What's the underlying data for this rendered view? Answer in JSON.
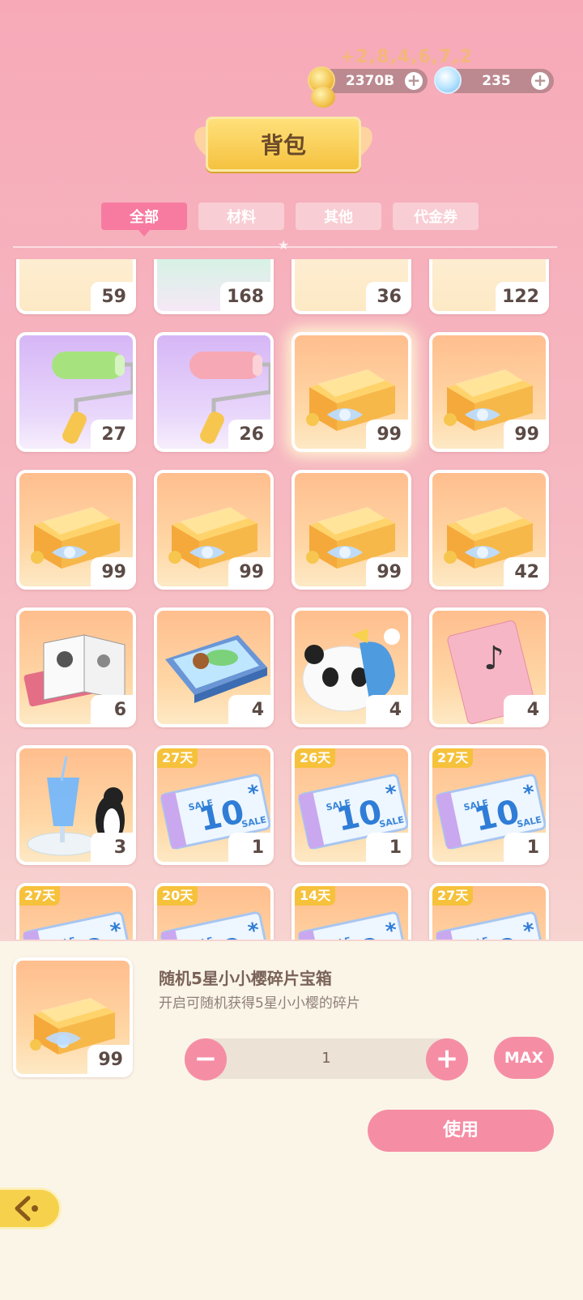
{
  "header": {
    "faded_label": "+2,8,4,6,7,2",
    "currencies": [
      {
        "name": "coin",
        "value": "2370B",
        "plus": "+"
      },
      {
        "name": "gem",
        "value": "235",
        "plus": "+"
      }
    ],
    "title": "背包"
  },
  "tabs": [
    {
      "label": "全部",
      "active": true
    },
    {
      "label": "材料",
      "active": false
    },
    {
      "label": "其他",
      "active": false
    },
    {
      "label": "代金券",
      "active": false
    }
  ],
  "items": [
    {
      "art": "card-icon",
      "count": "59",
      "days": ""
    },
    {
      "art": "ticket-blue-icon",
      "count": "168",
      "days": ""
    },
    {
      "art": "ticket-pink-icon",
      "count": "36",
      "days": ""
    },
    {
      "art": "ticket-yellow-icon",
      "count": "122",
      "days": ""
    },
    {
      "art": "green-roller-icon",
      "count": "27",
      "days": ""
    },
    {
      "art": "pink-roller-icon",
      "count": "26",
      "days": ""
    },
    {
      "art": "treasure-box-icon",
      "count": "99",
      "days": ""
    },
    {
      "art": "treasure-box-icon",
      "count": "99",
      "days": ""
    },
    {
      "art": "treasure-box-icon",
      "count": "99",
      "days": ""
    },
    {
      "art": "treasure-box-icon",
      "count": "99",
      "days": ""
    },
    {
      "art": "treasure-box-icon",
      "count": "99",
      "days": ""
    },
    {
      "art": "treasure-box-icon",
      "count": "42",
      "days": ""
    },
    {
      "art": "book-icon",
      "count": "6",
      "days": ""
    },
    {
      "art": "puzzle-box-icon",
      "count": "4",
      "days": ""
    },
    {
      "art": "panda-icon",
      "count": "4",
      "days": ""
    },
    {
      "art": "music-card-icon",
      "count": "4",
      "days": ""
    },
    {
      "art": "drink-penguin-icon",
      "count": "3",
      "days": ""
    },
    {
      "art": "coupon-icon",
      "count": "1",
      "days": "27天"
    },
    {
      "art": "coupon-icon",
      "count": "1",
      "days": "26天"
    },
    {
      "art": "coupon-icon",
      "count": "1",
      "days": "27天"
    },
    {
      "art": "coupon-icon",
      "count": "",
      "days": "27天"
    },
    {
      "art": "coupon-icon",
      "count": "",
      "days": "20天"
    },
    {
      "art": "coupon-icon",
      "count": "",
      "days": "14天"
    },
    {
      "art": "coupon-icon",
      "count": "",
      "days": "27天"
    }
  ],
  "coupon_text": {
    "sale": "SALE",
    "value": "10",
    "star": "*"
  },
  "selected": {
    "name": "随机5星小小樱碎片宝箱",
    "desc": "开启可随机获得5星小小樱的碎片",
    "count": "99",
    "quantity": "1",
    "minus": "−",
    "plus": "+",
    "max_label": "MAX",
    "use_label": "使用"
  },
  "colors": {
    "accent": "#f58ea5",
    "tab_active": "#f77ba0",
    "badge": "#f6c13b",
    "banner": "#f5c240"
  }
}
